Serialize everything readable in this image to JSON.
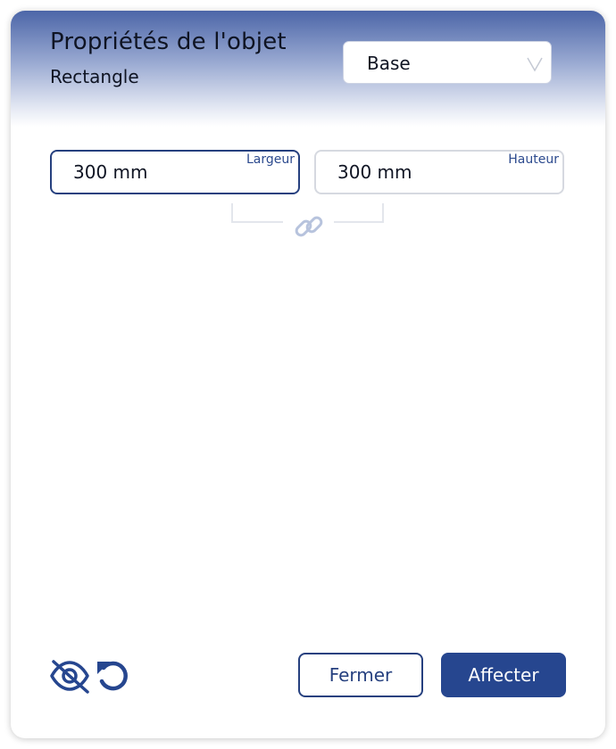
{
  "dialog": {
    "title": "Propriétés de l'objet",
    "subtitle": "Rectangle",
    "preset_select": {
      "value": "Base"
    }
  },
  "dimensions": {
    "width": {
      "label": "Largeur",
      "value": "300 mm"
    },
    "height": {
      "label": "Hauteur",
      "value": "300 mm"
    },
    "link_icon": "link-icon"
  },
  "footer": {
    "visibility_icon": "eye-slash-icon",
    "reset_icon": "undo-icon",
    "close_label": "Fermer",
    "apply_label": "Affecter"
  },
  "colors": {
    "accent": "#26468f",
    "header_gradient_top": "#4c66a8",
    "border_idle": "#d6d9e0",
    "link_icon": "#b7c3dd"
  }
}
